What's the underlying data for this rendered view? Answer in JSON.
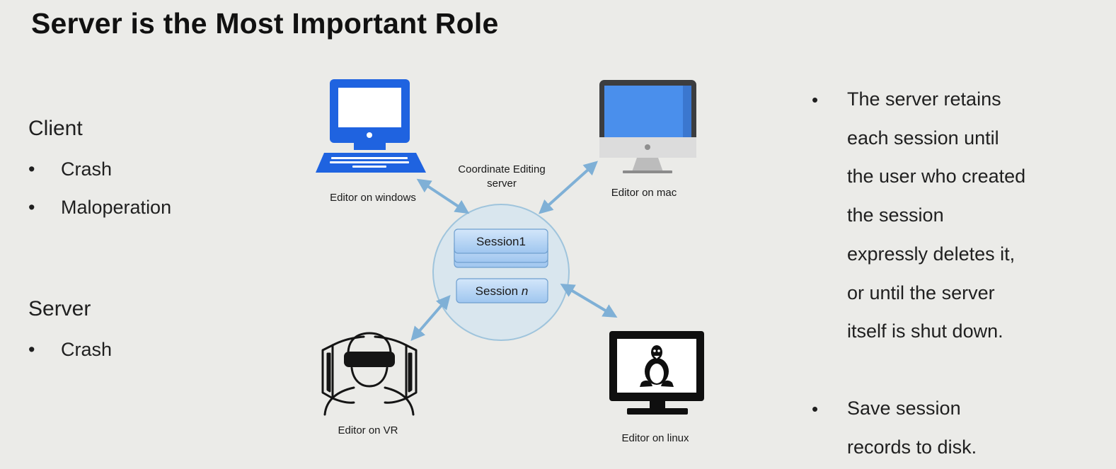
{
  "title": "Server is the Most Important Role",
  "left": {
    "client_heading": "Client",
    "client_items": [
      "Crash",
      "Maloperation"
    ],
    "server_heading": "Server",
    "server_items": [
      "Crash"
    ]
  },
  "diagram": {
    "server_label_line1": "Coordinate Editing",
    "server_label_line2": "server",
    "session_first": "Session1",
    "session_last_prefix": "Session ",
    "session_last_n": "n",
    "editors": {
      "windows": "Editor on windows",
      "mac": "Editor on mac",
      "vr": "Editor on VR",
      "linux": "Editor on linux"
    },
    "icons": {
      "windows": "windows-computer-icon",
      "mac": "mac-monitor-icon",
      "vr": "vr-headset-user-icon",
      "linux": "linux-monitor-icon"
    },
    "colors": {
      "arrow": "#7fb0d6",
      "windows_blue": "#1f63e0",
      "mac_screen": "#4a8fec",
      "circle_fill": "#d9e6ee",
      "session_fill": "#b3d3f4"
    }
  },
  "right": {
    "bullet1_lines": [
      "The server retains",
      "each session until",
      "the user who created",
      "the session",
      "expressly deletes it,",
      "or until the server",
      "itself is shut down."
    ],
    "bullet2_lines": [
      "Save session",
      "records to disk."
    ]
  }
}
